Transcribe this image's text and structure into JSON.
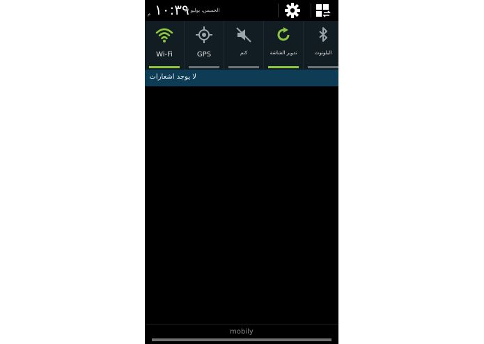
{
  "header": {
    "time": "١٠:٣٩",
    "ampm": "م",
    "date": "الخميس، يوليو ١٧",
    "settings_icon": "gear-icon",
    "edit_icon": "grid-swap-icon"
  },
  "toggles": [
    {
      "label": "Wi-Fi",
      "icon": "wifi-icon",
      "on": true
    },
    {
      "label": "GPS",
      "icon": "gps-icon",
      "on": false
    },
    {
      "label": "كتم",
      "icon": "mute-icon",
      "on": false
    },
    {
      "label": "تدوير الشاشة",
      "icon": "rotate-icon",
      "on": true
    },
    {
      "label": "البلوتوث",
      "icon": "bluetooth-icon",
      "on": false
    }
  ],
  "notifications": {
    "empty_text": "لا يوجد اشعارات"
  },
  "footer": {
    "carrier": "mobily"
  },
  "colors": {
    "accent_on": "#8dc63f",
    "accent_off": "#6a737a",
    "notif_bar": "#0e3c55"
  }
}
